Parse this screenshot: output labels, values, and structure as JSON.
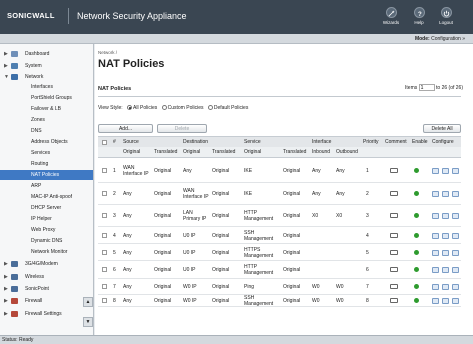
{
  "header": {
    "logo": "SONICWALL",
    "title": "Network Security Appliance",
    "buttons": [
      {
        "label": "Wizards",
        "icon": "wand-icon"
      },
      {
        "label": "Help",
        "icon": "help-icon"
      },
      {
        "label": "Logout",
        "icon": "power-icon"
      }
    ]
  },
  "mode": {
    "label": "Mode:",
    "value": "Configuration »"
  },
  "sidebar": {
    "items": [
      {
        "label": "Dashboard",
        "type": "top",
        "icon": "dashboard-icon",
        "color": "#6f8fb8"
      },
      {
        "label": "System",
        "type": "top",
        "icon": "system-icon",
        "color": "#4f7fb0"
      },
      {
        "label": "Network",
        "type": "top",
        "icon": "network-icon",
        "color": "#3d6fa8",
        "expanded": true
      },
      {
        "label": "Interfaces",
        "type": "sub"
      },
      {
        "label": "PortShield Groups",
        "type": "sub"
      },
      {
        "label": "Failover & LB",
        "type": "sub"
      },
      {
        "label": "Zones",
        "type": "sub"
      },
      {
        "label": "DNS",
        "type": "sub"
      },
      {
        "label": "Address Objects",
        "type": "sub"
      },
      {
        "label": "Services",
        "type": "sub"
      },
      {
        "label": "Routing",
        "type": "sub"
      },
      {
        "label": "NAT Policies",
        "type": "sub",
        "active": true
      },
      {
        "label": "ARP",
        "type": "sub"
      },
      {
        "label": "MAC-IP Anti-spoof",
        "type": "sub"
      },
      {
        "label": "DHCP Server",
        "type": "sub"
      },
      {
        "label": "IP Helper",
        "type": "sub"
      },
      {
        "label": "Web Proxy",
        "type": "sub"
      },
      {
        "label": "Dynamic DNS",
        "type": "sub"
      },
      {
        "label": "Network Monitor",
        "type": "sub"
      },
      {
        "label": "3G/4G/Modem",
        "type": "top",
        "icon": "modem-icon",
        "color": "#4a6d99"
      },
      {
        "label": "Wireless",
        "type": "top",
        "icon": "wireless-icon",
        "color": "#4a6d99"
      },
      {
        "label": "SonicPoint",
        "type": "top",
        "icon": "sonicpoint-icon",
        "color": "#4a6d99"
      },
      {
        "label": "Firewall",
        "type": "top",
        "icon": "firewall-icon",
        "color": "#b5483a"
      },
      {
        "label": "Firewall Settings",
        "type": "top",
        "icon": "firewall-settings-icon",
        "color": "#b5483a"
      }
    ]
  },
  "status": "Status: Ready",
  "main": {
    "breadcrumb": "Network /",
    "title": "NAT Policies",
    "section": "NAT Policies",
    "items_label": "Items",
    "items_value": "1",
    "items_range": "to 26 (of 26)",
    "view_style_label": "View Style:",
    "view_options": [
      {
        "label": "All Policies",
        "selected": true
      },
      {
        "label": "Custom Policies",
        "selected": false
      },
      {
        "label": "Default Policies",
        "selected": false
      }
    ],
    "add_button": "Add...",
    "delete_button": "Delete",
    "delete_all_button": "Delete All"
  },
  "table": {
    "group_headers": {
      "hash": "#",
      "source": "Source",
      "destination": "Destination",
      "service": "Service",
      "interface": "Interface",
      "priority": "Priority",
      "comment": "Comment",
      "enable": "Enable",
      "configure": "Configure"
    },
    "sub_headers": {
      "src_orig": "Original",
      "src_trans": "Translated",
      "dst_orig": "Original",
      "dst_trans": "Translated",
      "svc_orig": "Original",
      "svc_trans": "Translated",
      "inbound": "Inbound",
      "outbound": "Outbound"
    },
    "rows": [
      {
        "num": "1",
        "src_orig": "WAN Interface IP",
        "src_trans": "Original",
        "dst_orig": "Any",
        "dst_trans": "Original",
        "svc_orig": "IKE",
        "svc_trans": "Original",
        "inbound": "Any",
        "outbound": "Any",
        "priority": "1"
      },
      {
        "num": "2",
        "src_orig": "Any",
        "src_trans": "Original",
        "dst_orig": "WAN Interface IP",
        "dst_trans": "Original",
        "svc_orig": "IKE",
        "svc_trans": "Original",
        "inbound": "Any",
        "outbound": "Any",
        "priority": "2"
      },
      {
        "num": "3",
        "src_orig": "Any",
        "src_trans": "Original",
        "dst_orig": "LAN Primary IP",
        "dst_trans": "Original",
        "svc_orig": "HTTP Management",
        "svc_trans": "Original",
        "inbound": "X0",
        "outbound": "X0",
        "priority": "3"
      },
      {
        "num": "4",
        "src_orig": "Any",
        "src_trans": "Original",
        "dst_orig": "U0 IP",
        "dst_trans": "Original",
        "svc_orig": "SSH Management",
        "svc_trans": "Original",
        "inbound": "",
        "outbound": "",
        "priority": "4"
      },
      {
        "num": "5",
        "src_orig": "Any",
        "src_trans": "Original",
        "dst_orig": "U0 IP",
        "dst_trans": "Original",
        "svc_orig": "HTTPS Management",
        "svc_trans": "Original",
        "inbound": "",
        "outbound": "",
        "priority": "5"
      },
      {
        "num": "6",
        "src_orig": "Any",
        "src_trans": "Original",
        "dst_orig": "U0 IP",
        "dst_trans": "Original",
        "svc_orig": "HTTP Management",
        "svc_trans": "Original",
        "inbound": "",
        "outbound": "",
        "priority": "6"
      },
      {
        "num": "7",
        "src_orig": "Any",
        "src_trans": "Original",
        "dst_orig": "W0 IP",
        "dst_trans": "Original",
        "svc_orig": "Ping",
        "svc_trans": "Original",
        "inbound": "W0",
        "outbound": "W0",
        "priority": "7"
      },
      {
        "num": "8",
        "src_orig": "Any",
        "src_trans": "Original",
        "dst_orig": "W0 IP",
        "dst_trans": "Original",
        "svc_orig": "SSH Management",
        "svc_trans": "Original",
        "inbound": "W0",
        "outbound": "W0",
        "priority": "8"
      }
    ]
  }
}
